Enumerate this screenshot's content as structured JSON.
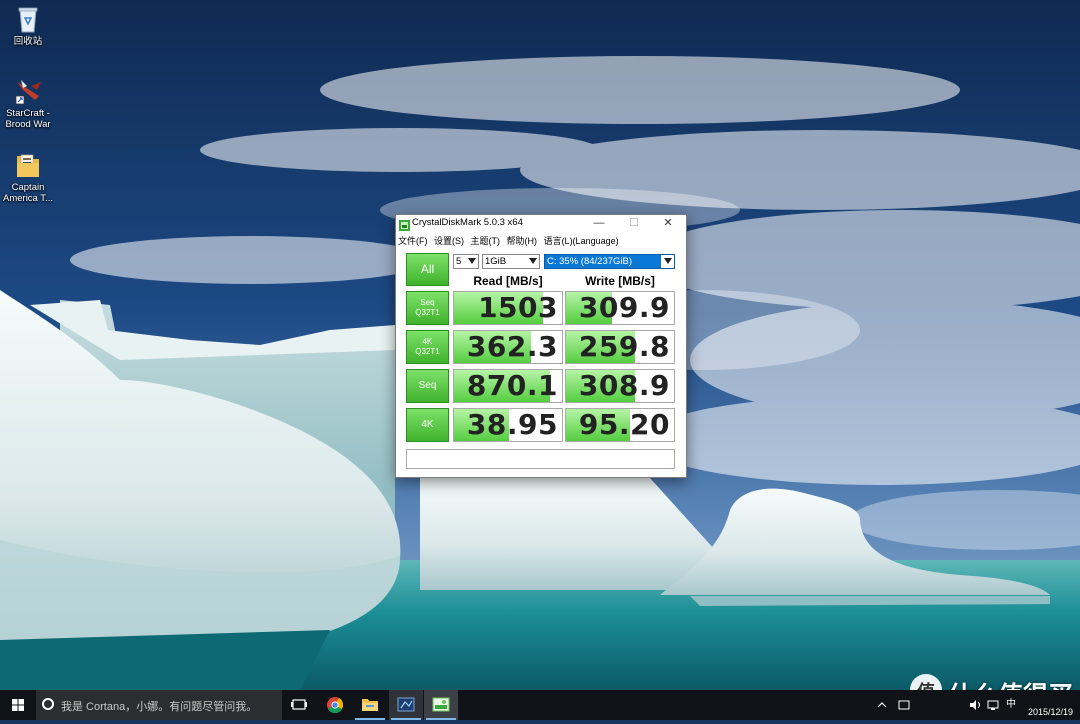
{
  "desktop": {
    "icons": [
      {
        "label": "回收站",
        "icon": "recycle-bin-icon"
      },
      {
        "label": "StarCraft - Brood War",
        "label_l1": "StarCraft -",
        "label_l2": "Brood War",
        "icon": "starcraft-icon"
      },
      {
        "label": "Captain America T...",
        "label_l1": "Captain",
        "label_l2": "America T...",
        "icon": "folder-icon"
      }
    ]
  },
  "window": {
    "title": "CrystalDiskMark 5.0.3 x64",
    "controls": {
      "minimize": "—",
      "maximize": "☐",
      "close": "✕"
    },
    "menu": [
      "文件(F)",
      "设置(S)",
      "主题(T)",
      "帮助(H)",
      "语言(L)(Language)"
    ],
    "test_count": "5",
    "test_size": "1GiB",
    "drive": "C: 35% (84/237GiB)",
    "all_button": "All",
    "read_header": "Read [MB/s]",
    "write_header": "Write [MB/s]",
    "rows": [
      {
        "label_l1": "Seq",
        "label_l2": "Q32T1",
        "read": "1503",
        "write": "309.9",
        "read_fill": 0.82,
        "write_fill": 0.43
      },
      {
        "label_l1": "4K",
        "label_l2": "Q32T1",
        "read": "362.3",
        "write": "259.8",
        "read_fill": 0.71,
        "write_fill": 0.64
      },
      {
        "label_l1": "Seq",
        "label_l2": "",
        "read": "870.1",
        "write": "308.9",
        "read_fill": 0.89,
        "write_fill": 0.64
      },
      {
        "label_l1": "4K",
        "label_l2": "",
        "read": "38.95",
        "write": "95.20",
        "read_fill": 0.51,
        "write_fill": 0.59
      }
    ],
    "comment": ""
  },
  "taskbar": {
    "cortana_placeholder": "我是 Cortana，小娜。有问题尽管问我。",
    "apps": [
      "task-view-icon",
      "chrome-icon",
      "file-explorer-icon",
      "app-icon",
      "crystaldiskmark-icon"
    ],
    "date": "2015/12/19",
    "tray_ime": "中"
  },
  "watermark": {
    "logo": "值",
    "text": "什么值得买"
  },
  "colors": {
    "accent_green": "#54cd3f",
    "drive_highlight": "#0a78d7",
    "taskbar": "#0f1216"
  }
}
